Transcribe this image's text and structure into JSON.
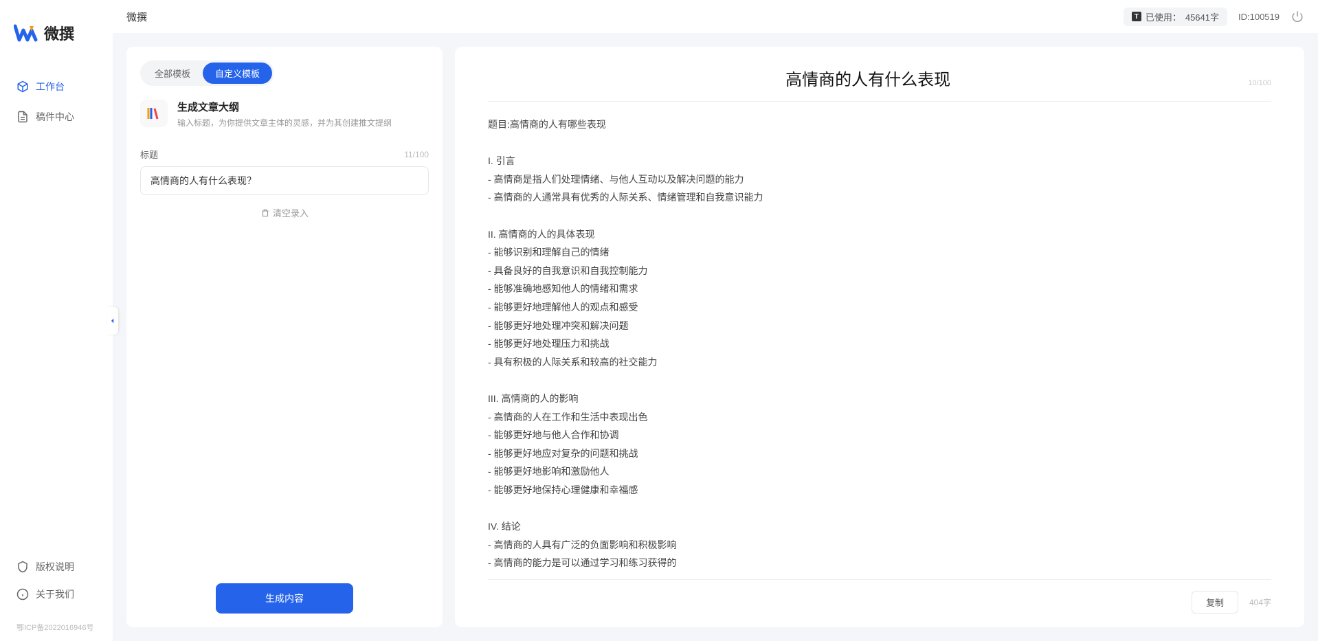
{
  "app": {
    "name": "微撰",
    "icp": "鄂ICP备2022016946号"
  },
  "sidebar": {
    "nav": [
      {
        "label": "工作台",
        "icon": "cube",
        "active": true
      },
      {
        "label": "稿件中心",
        "icon": "file",
        "active": false
      }
    ],
    "footer": [
      {
        "label": "版权说明",
        "icon": "shield"
      },
      {
        "label": "关于我们",
        "icon": "info"
      }
    ]
  },
  "topbar": {
    "title": "微撰",
    "usage_label": "已使用：",
    "usage_value": "45641字",
    "user_id": "ID:100519"
  },
  "left_panel": {
    "tabs": [
      {
        "label": "全部模板",
        "active": false
      },
      {
        "label": "自定义模板",
        "active": true
      }
    ],
    "template": {
      "title": "生成文章大纲",
      "desc": "输入标题，为你提供文章主体的灵感，并为其创建推文提纲"
    },
    "form": {
      "label": "标题",
      "counter": "11/100",
      "value": "高情商的人有什么表现？"
    },
    "clear_label": "清空录入",
    "generate_label": "生成内容"
  },
  "output": {
    "title": "高情商的人有什么表现",
    "title_counter": "10/100",
    "body": "题目:高情商的人有哪些表现\n\nI. 引言\n- 高情商是指人们处理情绪、与他人互动以及解决问题的能力\n- 高情商的人通常具有优秀的人际关系、情绪管理和自我意识能力\n\nII. 高情商的人的具体表现\n- 能够识别和理解自己的情绪\n- 具备良好的自我意识和自我控制能力\n- 能够准确地感知他人的情绪和需求\n- 能够更好地理解他人的观点和感受\n- 能够更好地处理冲突和解决问题\n- 能够更好地处理压力和挑战\n- 具有积极的人际关系和较高的社交能力\n\nIII. 高情商的人的影响\n- 高情商的人在工作和生活中表现出色\n- 能够更好地与他人合作和协调\n- 能够更好地应对复杂的问题和挑战\n- 能够更好地影响和激励他人\n- 能够更好地保持心理健康和幸福感\n\nIV. 结论\n- 高情商的人具有广泛的负面影响和积极影响\n- 高情商的能力是可以通过学习和练习获得的\n- 培养和提高高情商的能力对于个人的职业发展和生活质量至关重要。",
    "copy_label": "复制",
    "word_count": "404字"
  }
}
